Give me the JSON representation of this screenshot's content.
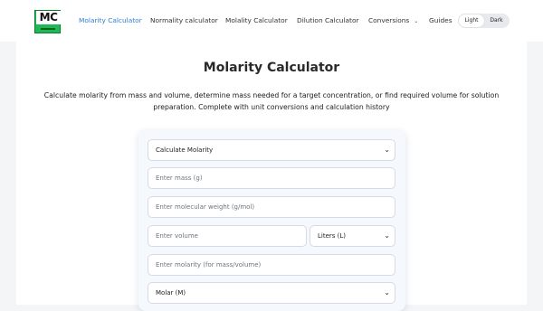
{
  "logo": {
    "text": "MC"
  },
  "nav": {
    "items": [
      {
        "label": "Molarity Calculator"
      },
      {
        "label": "Normality calculator"
      },
      {
        "label": "Molality Calculator"
      },
      {
        "label": "Dilution Calculator"
      },
      {
        "label": "Conversions"
      },
      {
        "label": "Guides"
      }
    ],
    "active_color": "#2b7fd6"
  },
  "theme": {
    "light": "Light",
    "dark": "Dark"
  },
  "page": {
    "title": "Molarity Calculator",
    "description": "Calculate molarity from mass and volume, determine mass needed for a target concentration, or find required volume for solution preparation. Complete with unit conversions and calculation history"
  },
  "form": {
    "mode_select": "Calculate Molarity",
    "mass_placeholder": "Enter mass (g)",
    "mw_placeholder": "Enter molecular weight (g/mol)",
    "volume_placeholder": "Enter volume",
    "volume_unit": "Liters (L)",
    "molarity_placeholder": "Enter molarity (for mass/volume)",
    "molarity_unit": "Molar (M)"
  }
}
